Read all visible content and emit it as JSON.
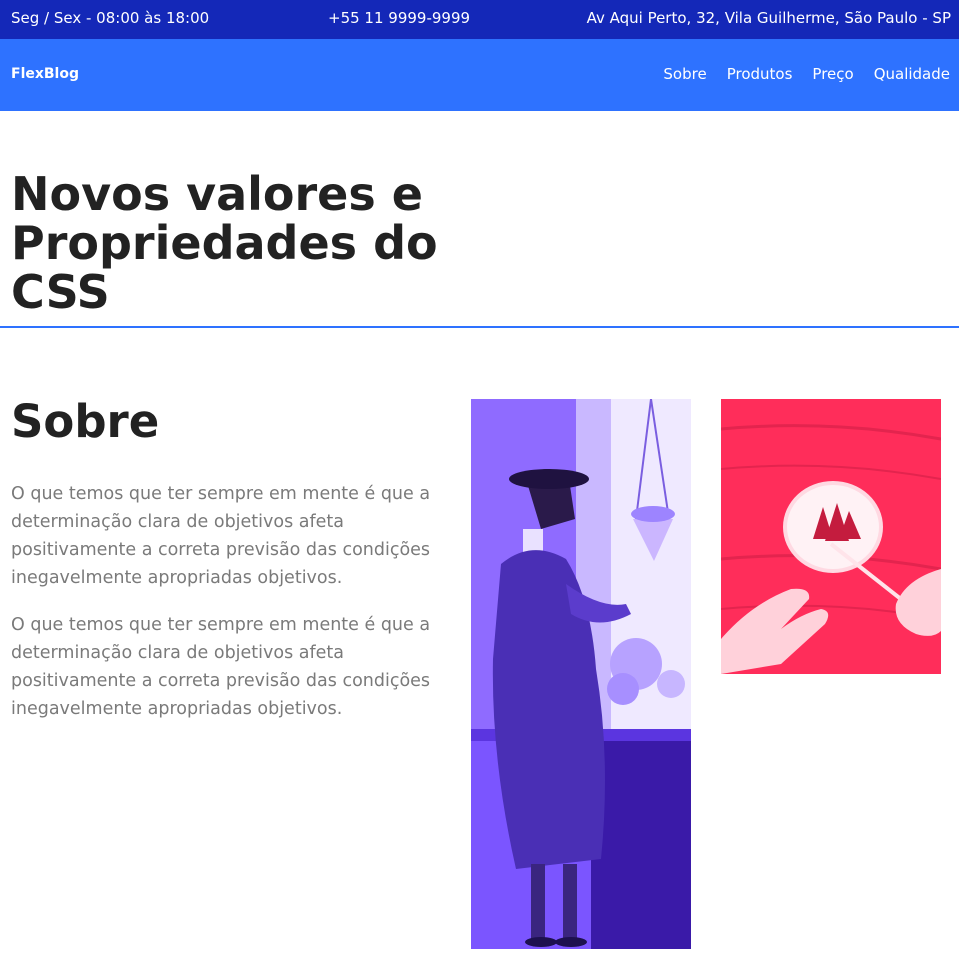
{
  "topbar": {
    "hours": "Seg / Sex - 08:00 às 18:00",
    "phone": "+55 11 9999-9999",
    "address": "Av Aqui Perto, 32, Vila Guilherme, São Paulo - SP"
  },
  "nav": {
    "logo": "FlexBlog",
    "items": [
      {
        "label": "Sobre"
      },
      {
        "label": "Produtos"
      },
      {
        "label": "Preço"
      },
      {
        "label": "Qualidade"
      }
    ]
  },
  "hero": {
    "title": "Novos valores e Propriedades do CSS"
  },
  "about": {
    "title": "Sobre",
    "paragraphs": [
      "O que temos que ter sempre em mente é que a determinação clara de objetivos afeta positivamente a correta previsão das condições inegavelmente apropriadas objetivos.",
      "O que temos que ter sempre em mente é que a determinação clara de objetivos afeta positivamente a correta previsão das condições inegavelmente apropriadas objetivos."
    ]
  },
  "colors": {
    "topbar": "#1428b8",
    "navbar": "#2e72ff",
    "divider": "#2e72ff",
    "photo1_tint": "#6a3cff",
    "photo2_tint": "#ff2d5a"
  }
}
